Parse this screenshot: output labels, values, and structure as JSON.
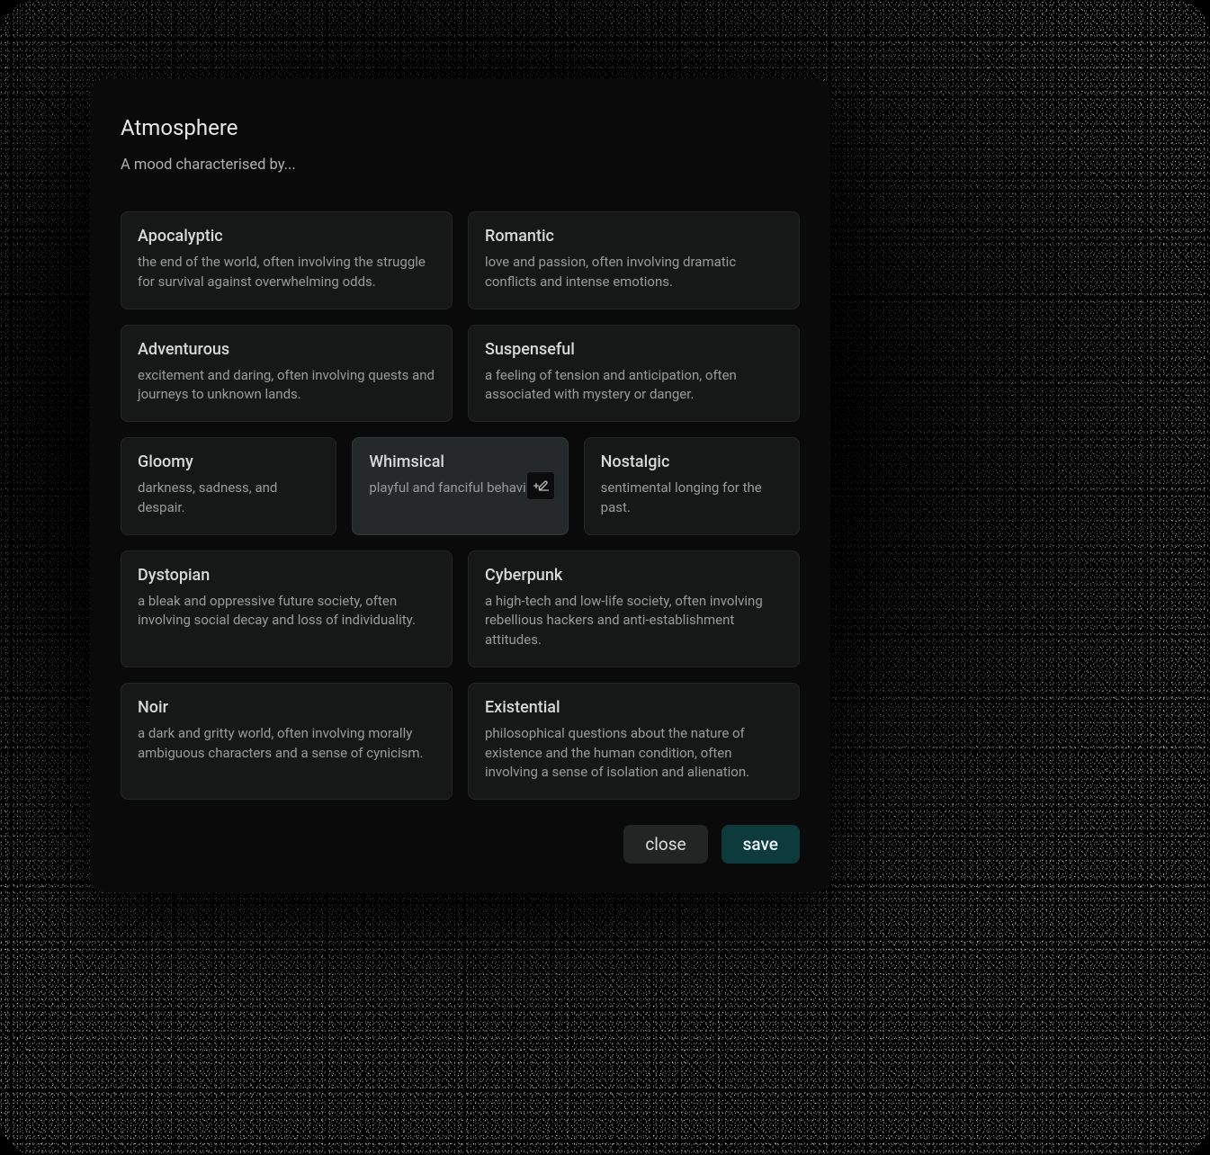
{
  "modal": {
    "title": "Atmosphere",
    "subtitle": "A mood characterised by..."
  },
  "rows": [
    {
      "layout": "two",
      "cards": [
        {
          "name": "Apocalyptic",
          "desc": "the end of the world, often involving the struggle for survival against overwhelming odds.",
          "active": false,
          "edit": false
        },
        {
          "name": "Romantic",
          "desc": "love and passion, often involving dramatic conflicts and intense emotions.",
          "active": false,
          "edit": false
        }
      ]
    },
    {
      "layout": "two",
      "cards": [
        {
          "name": "Adventurous",
          "desc": "excitement and daring, often involving quests and journeys to unknown lands.",
          "active": false,
          "edit": false
        },
        {
          "name": "Suspenseful",
          "desc": "a feeling of tension and anticipation, often associated with mystery or danger.",
          "active": false,
          "edit": false
        }
      ]
    },
    {
      "layout": "three",
      "cards": [
        {
          "name": "Gloomy",
          "desc": "darkness, sadness, and despair.",
          "active": false,
          "edit": false
        },
        {
          "name": "Whimsical",
          "desc": "playful and fanciful behavior.",
          "active": true,
          "edit": true
        },
        {
          "name": "Nostalgic",
          "desc": "sentimental longing for the past.",
          "active": false,
          "edit": false
        }
      ]
    },
    {
      "layout": "two",
      "cards": [
        {
          "name": "Dystopian",
          "desc": "a bleak and oppressive future society, often involving social decay and loss of individuality.",
          "active": false,
          "edit": false
        },
        {
          "name": "Cyberpunk",
          "desc": "a high-tech and low-life society, often involving rebellious hackers and anti-establishment attitudes.",
          "active": false,
          "edit": false
        }
      ]
    },
    {
      "layout": "two",
      "cards": [
        {
          "name": "Noir",
          "desc": "a dark and gritty world, often involving morally ambiguous characters and a sense of cynicism.",
          "active": false,
          "edit": false
        },
        {
          "name": "Existential",
          "desc": "philosophical questions about the nature of existence and the human condition, often involving a sense of isolation and alienation.",
          "active": false,
          "edit": false
        }
      ]
    }
  ],
  "actions": {
    "close_label": "close",
    "save_label": "save"
  }
}
